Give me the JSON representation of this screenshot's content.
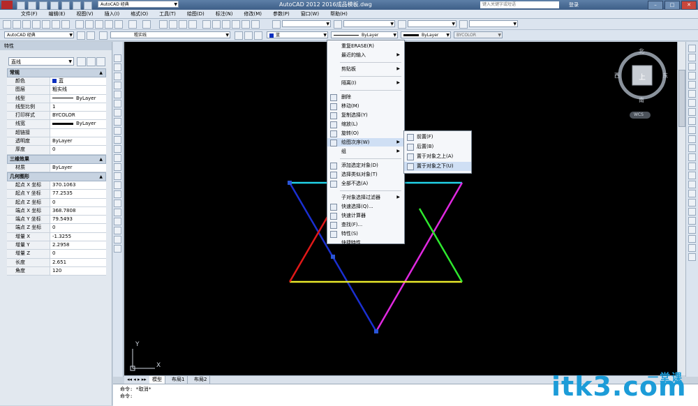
{
  "window": {
    "title": "AutoCAD 2012    2016成品模板.dwg",
    "search_placeholder": "键入关键字或短语",
    "login": "登录",
    "min": "–",
    "max": "□",
    "close": "✕"
  },
  "menubar": [
    "文件(F)",
    "编辑(E)",
    "视图(V)",
    "插入(I)",
    "格式(O)",
    "工具(T)",
    "绘图(D)",
    "标注(N)",
    "修改(M)",
    "参数(P)",
    "窗口(W)",
    "帮助(H)"
  ],
  "toolbars": {
    "workspace_top": "AutoCAD 经典",
    "workspace": "AutoCAD 经典",
    "layer": "粗实线",
    "color": "蓝",
    "linetype": "ByLayer",
    "lineweight": "ByLayer",
    "plotstyle": "BYCOLOR"
  },
  "properties": {
    "panel_title": "特性",
    "object_type": "直线",
    "sections": [
      {
        "title": "常规",
        "rows": [
          {
            "k": "颜色",
            "v": "蓝",
            "swatch": "#0a2fbf"
          },
          {
            "k": "图层",
            "v": "粗实线"
          },
          {
            "k": "线型",
            "v": "ByLayer",
            "line": "thin"
          },
          {
            "k": "线型比例",
            "v": "1"
          },
          {
            "k": "打印样式",
            "v": "BYCOLOR"
          },
          {
            "k": "线宽",
            "v": "ByLayer",
            "line": "thick"
          },
          {
            "k": "超链接",
            "v": ""
          },
          {
            "k": "透明度",
            "v": "ByLayer"
          },
          {
            "k": "厚度",
            "v": "0"
          }
        ]
      },
      {
        "title": "三维效果",
        "rows": [
          {
            "k": "材质",
            "v": "ByLayer"
          }
        ]
      },
      {
        "title": "几何图形",
        "rows": [
          {
            "k": "起点 X 坐标",
            "v": "370.1063"
          },
          {
            "k": "起点 Y 坐标",
            "v": "77.2535"
          },
          {
            "k": "起点 Z 坐标",
            "v": "0"
          },
          {
            "k": "端点 X 坐标",
            "v": "368.7808"
          },
          {
            "k": "端点 Y 坐标",
            "v": "79.5493"
          },
          {
            "k": "端点 Z 坐标",
            "v": "0"
          },
          {
            "k": "增量 X",
            "v": "-1.3255"
          },
          {
            "k": "增量 Y",
            "v": "2.2958"
          },
          {
            "k": "增量 Z",
            "v": "0"
          },
          {
            "k": "长度",
            "v": "2.651"
          },
          {
            "k": "角度",
            "v": "120"
          }
        ]
      }
    ]
  },
  "context_menu": [
    {
      "label": "重复ERASE(R)"
    },
    {
      "label": "最近的输入",
      "sub": true
    },
    {
      "sep": true
    },
    {
      "label": "剪贴板",
      "sub": true
    },
    {
      "sep": true
    },
    {
      "label": "隔离(I)",
      "sub": true
    },
    {
      "sep": true
    },
    {
      "label": "删除",
      "icon": "eraser-icon"
    },
    {
      "label": "移动(M)",
      "icon": "move-icon"
    },
    {
      "label": "复制选择(Y)",
      "icon": "copy-icon"
    },
    {
      "label": "缩放(L)",
      "icon": "scale-icon"
    },
    {
      "label": "旋转(O)",
      "icon": "rotate-icon"
    },
    {
      "label": "绘图次序(W)",
      "icon": "draworder-icon",
      "sub": true,
      "highlight": true
    },
    {
      "label": "组",
      "sub": true
    },
    {
      "sep": true
    },
    {
      "label": "添加选定对象(D)",
      "icon": "add-selected-icon"
    },
    {
      "label": "选择类似对象(T)",
      "icon": "select-similar-icon"
    },
    {
      "label": "全部不选(A)",
      "icon": "deselect-icon"
    },
    {
      "sep": true
    },
    {
      "label": "子对象选择过滤器",
      "sub": true
    },
    {
      "label": "快速选择(Q)...",
      "icon": "quickselect-icon"
    },
    {
      "label": "快速计算器",
      "icon": "calculator-icon"
    },
    {
      "label": "查找(F)...",
      "icon": "find-icon"
    },
    {
      "label": "特性(S)",
      "icon": "properties-icon"
    },
    {
      "label": "快捷特性"
    }
  ],
  "submenu": [
    {
      "label": "前置(F)"
    },
    {
      "label": "后置(B)"
    },
    {
      "label": "置于对象之上(A)"
    },
    {
      "label": "置于对象之下(U)",
      "highlight": true
    }
  ],
  "navcube": {
    "north": "北",
    "south": "南",
    "east": "东",
    "west": "西",
    "top": "上",
    "wcs": "WCS"
  },
  "tabs": [
    "模型",
    "布局1",
    "布局2"
  ],
  "command_lines": [
    "命令: *取消*",
    "命令:"
  ],
  "ucs": {
    "x": "X",
    "y": "Y"
  },
  "watermark": {
    "text": "itk3.com",
    "cn": "一堂课"
  },
  "colors": {
    "canvas": "#000000",
    "cyan": "#22d3e8",
    "blue": "#1a2fd0",
    "green": "#2ee82e",
    "magenta": "#e028e0",
    "red": "#e01818",
    "yellow": "#e8e82a"
  }
}
